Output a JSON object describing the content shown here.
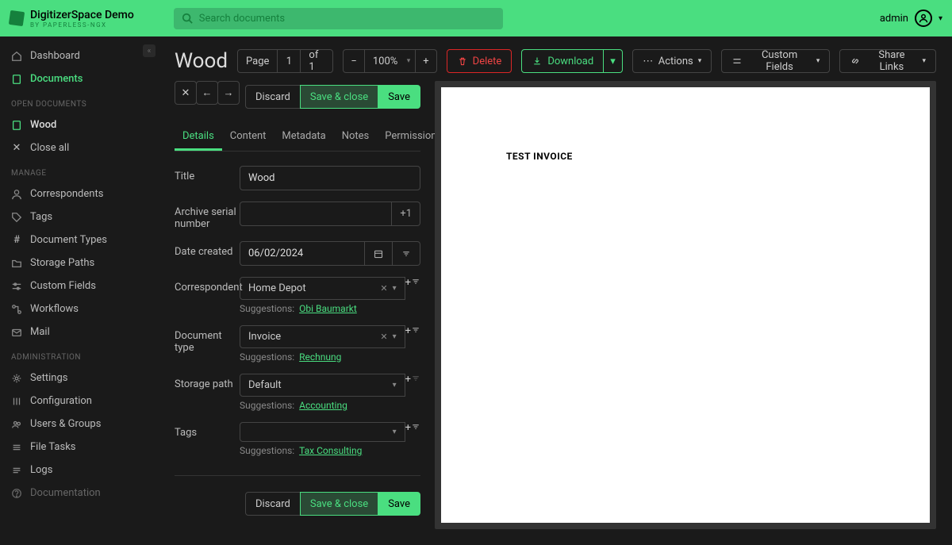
{
  "header": {
    "app_name": "DigitizerSpace Demo",
    "app_sub": "BY PAPERLESS-NGX",
    "search_placeholder": "Search documents",
    "user": "admin"
  },
  "sidebar": {
    "dashboard": "Dashboard",
    "documents": "Documents",
    "open_docs_label": "OPEN DOCUMENTS",
    "open_doc": "Wood",
    "close_all": "Close all",
    "manage_label": "MANAGE",
    "correspondents": "Correspondents",
    "tags": "Tags",
    "doc_types": "Document Types",
    "storage_paths": "Storage Paths",
    "custom_fields": "Custom Fields",
    "workflows": "Workflows",
    "mail": "Mail",
    "admin_label": "ADMINISTRATION",
    "settings": "Settings",
    "configuration": "Configuration",
    "users_groups": "Users & Groups",
    "file_tasks": "File Tasks",
    "logs": "Logs",
    "documentation": "Documentation"
  },
  "doc": {
    "title": "Wood",
    "page_label": "Page",
    "page_current": "1",
    "page_of": "of 1",
    "zoom": "100%",
    "delete": "Delete",
    "download": "Download",
    "actions": "Actions",
    "custom_fields_btn": "Custom Fields",
    "share_links": "Share Links",
    "discard": "Discard",
    "save_close": "Save & close",
    "save": "Save",
    "tabs": {
      "details": "Details",
      "content": "Content",
      "metadata": "Metadata",
      "notes": "Notes",
      "permissions": "Permissions"
    },
    "form": {
      "title_label": "Title",
      "title_value": "Wood",
      "asn_label": "Archive serial number",
      "asn_addon": "+1",
      "date_label": "Date created",
      "date_value": "06/02/2024",
      "correspondent_label": "Correspondent",
      "correspondent_value": "Home Depot",
      "correspondent_sugg": "Obi Baumarkt",
      "doctype_label": "Document type",
      "doctype_value": "Invoice",
      "doctype_sugg": "Rechnung",
      "storage_label": "Storage path",
      "storage_value": "Default",
      "storage_sugg": "Accounting",
      "tags_label": "Tags",
      "tags_sugg": "Tax Consulting",
      "sugg_prefix": "Suggestions:"
    },
    "preview_text": "TEST INVOICE"
  }
}
